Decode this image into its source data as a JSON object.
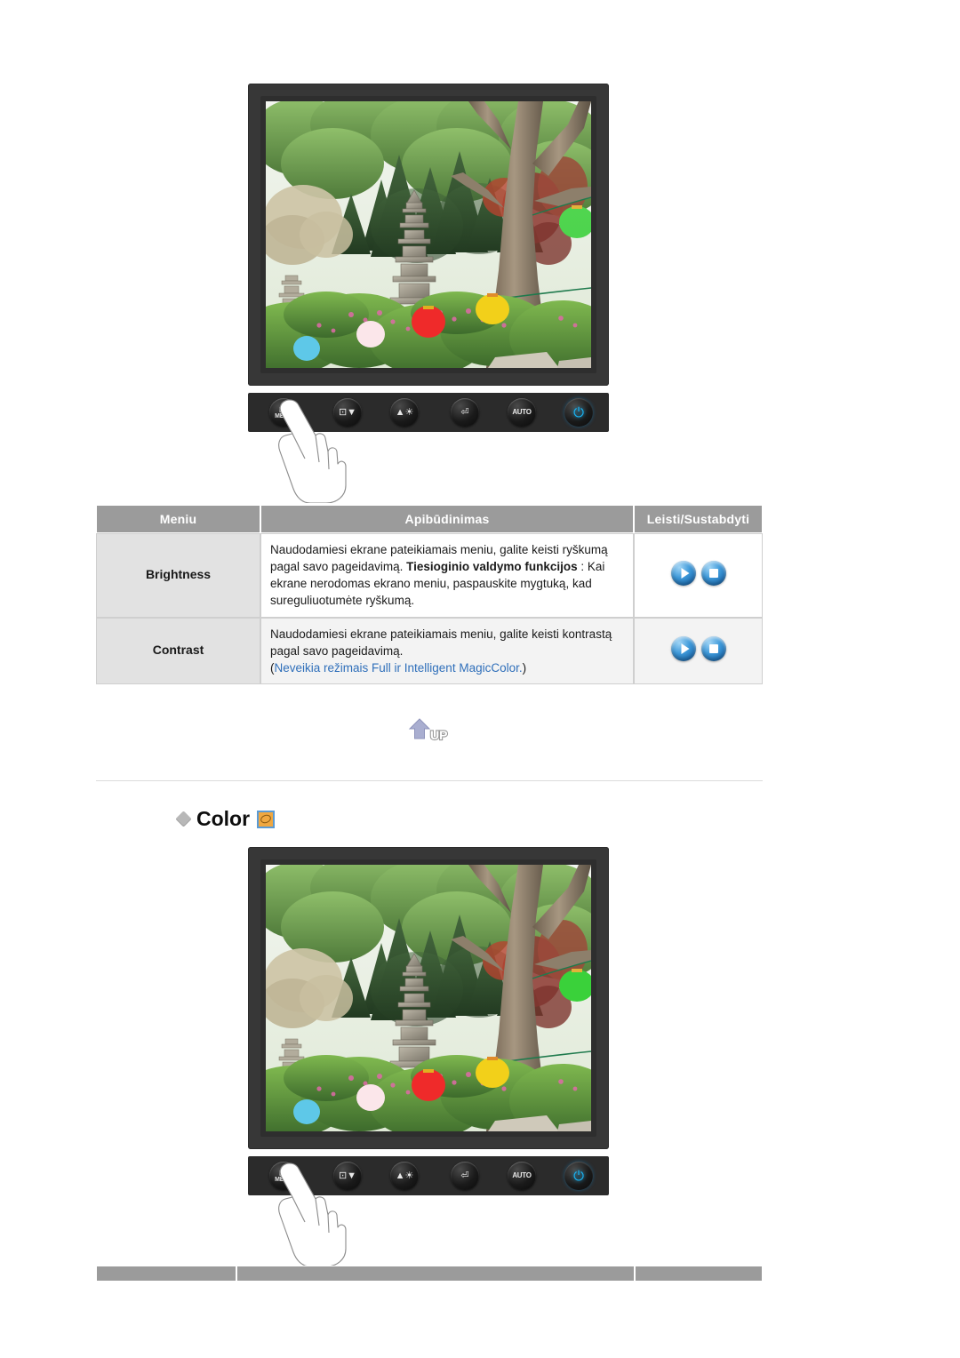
{
  "page": {
    "language": "lt",
    "background": "#ffffff"
  },
  "figures": [
    {
      "name": "monitor-brightness",
      "alt": "Monitor displaying garden photo with stone pagoda and paper lanterns",
      "buttons": [
        {
          "name": "menu-button",
          "label": "MENU",
          "glyph": "menu-bars"
        },
        {
          "name": "source-down-button",
          "label": "",
          "glyph": "source-down"
        },
        {
          "name": "brightness-button",
          "label": "",
          "glyph": "brightness"
        },
        {
          "name": "enter-button",
          "label": "",
          "glyph": "enter"
        },
        {
          "name": "auto-button",
          "label": "AUTO",
          "glyph": ""
        },
        {
          "name": "power-button",
          "label": "",
          "glyph": "power"
        }
      ],
      "pointing_hand": true
    },
    {
      "name": "monitor-color",
      "alt": "Monitor displaying garden photo with stone pagoda and paper lanterns",
      "buttons": [
        {
          "name": "menu-button",
          "label": "MENU",
          "glyph": "menu-bars"
        },
        {
          "name": "source-down-button",
          "label": "",
          "glyph": "source-down"
        },
        {
          "name": "brightness-button",
          "label": "",
          "glyph": "brightness"
        },
        {
          "name": "enter-button",
          "label": "",
          "glyph": "enter"
        },
        {
          "name": "auto-button",
          "label": "AUTO",
          "glyph": ""
        },
        {
          "name": "power-button",
          "label": "",
          "glyph": "power"
        }
      ],
      "pointing_hand": true
    }
  ],
  "table": {
    "headers": [
      "Meniu",
      "Apibūdinimas",
      "Leisti/Sustabdyti"
    ],
    "rows": [
      {
        "menu": "Brightness",
        "desc_line1": "Naudodamiesi ekrane pateikiamais meniu, galite keisti ryškumą pagal savo pageidavimą.",
        "desc_bold": "Tiesioginio valdymo funkcijos",
        "desc_line2": " : Kai ekrane nerodomas ekrano meniu, paspauskite mygtuką, kad sureguliuotumėte ryškumą.",
        "desc_note": "",
        "controls": [
          "play",
          "stop"
        ]
      },
      {
        "menu": "Contrast",
        "desc_line1": "Naudodamiesi ekrane pateikiamais meniu, galite keisti kontrastą pagal savo pageidavimą.",
        "desc_bold": "",
        "desc_line2": "",
        "desc_note_open": "(",
        "desc_note": "Neveikia režimais Full ir Intelligent MagicColor.",
        "desc_note_close": ")",
        "controls": [
          "play",
          "stop"
        ]
      }
    ]
  },
  "up_button": {
    "label": "UP",
    "name": "up-scroll-button"
  },
  "section": {
    "title": "Color",
    "bullet": "diamond-bullet-icon",
    "chip": "color-palette-icon"
  },
  "colors": {
    "header_gray": "#9b9b9b",
    "menu_cell_gray": "#e2e2e2",
    "alt_row": "#f3f3f3",
    "note_blue": "#2f6fba",
    "monitor_frame": "#373737",
    "chip_orange": "#f0a841",
    "chip_border_blue": "#5b9bd5",
    "power_led": "#18b4f5"
  }
}
